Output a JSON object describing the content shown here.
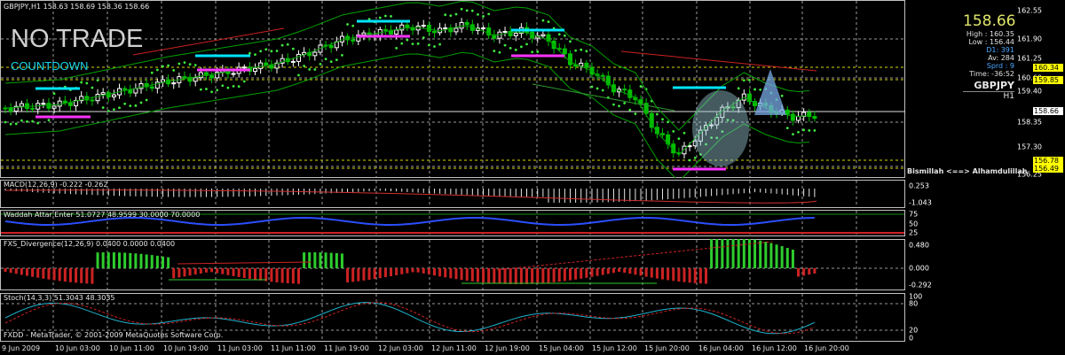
{
  "chart_header": "GBPJPY,H1  158.63 158.69 158.36 158.66",
  "overlay": {
    "title": "NO TRADE",
    "subtitle": "COUNTDOWN"
  },
  "info_box": {
    "price": "158.66",
    "high": "High : 160.35",
    "low": "Low : 156.44",
    "d1_label": "D1:",
    "d1_value": "391",
    "av_label": "Av:",
    "av_value": "284",
    "sprd_label": "Sprd :",
    "sprd_value": "9",
    "time": "Time:  -36:52",
    "symbol": "GBPJPY",
    "timeframe": "H1"
  },
  "price_axis": [
    "162.55",
    "161.90",
    "161.25",
    "160.60",
    "159.40",
    "158.35",
    "157.30",
    "156.25"
  ],
  "price_tags": {
    "t1": "160.34",
    "t2": "159.85",
    "t3": "158.66",
    "t4": "156.78",
    "t5": "156.49"
  },
  "footer_note": "Bismillah <==> Alhamdulillah",
  "indicators": {
    "macd": {
      "title": "MACD(12,26,9) -0.222 -0.262",
      "axis": [
        "0.253",
        "-1.043"
      ]
    },
    "waddah": {
      "title": "Waddah Attar Enter 51.0727 48.9599 30.0000 70.0000",
      "axis": [
        "75",
        "50",
        "25"
      ]
    },
    "fxs": {
      "title": "FXS_Divergence(12,26,9) 0.0400 0.0000 0.0400",
      "axis": [
        "0.480",
        "0.000",
        "-0.292"
      ]
    },
    "stoch": {
      "title": "Stoch(14,3,3) 51.3043 48.3035",
      "axis": [
        "100",
        "80",
        "20",
        "0"
      ]
    }
  },
  "copyright": "FXDD - MetaTrader, © 2001-2009 MetaQuotes Software Corp.",
  "time_axis": [
    "9 Jun 2009",
    "10 Jun 03:00",
    "10 Jun 11:00",
    "10 Jun 19:00",
    "11 Jun 03:00",
    "11 Jun 11:00",
    "11 Jun 19:00",
    "12 Jun 03:00",
    "12 Jun 11:00",
    "12 Jun 19:00",
    "15 Jun 04:00",
    "15 Jun 12:00",
    "15 Jun 20:00",
    "16 Jun 04:00",
    "16 Jun 12:00",
    "16 Jun 20:00"
  ],
  "colors": {
    "bull": "#ffffff",
    "bear": "#00c000",
    "bbands": "#00a000",
    "sar": "#3fe83f",
    "level_cyan": "#00e5ff",
    "level_magenta": "#ff33ff",
    "trend": "#cc2222"
  }
}
